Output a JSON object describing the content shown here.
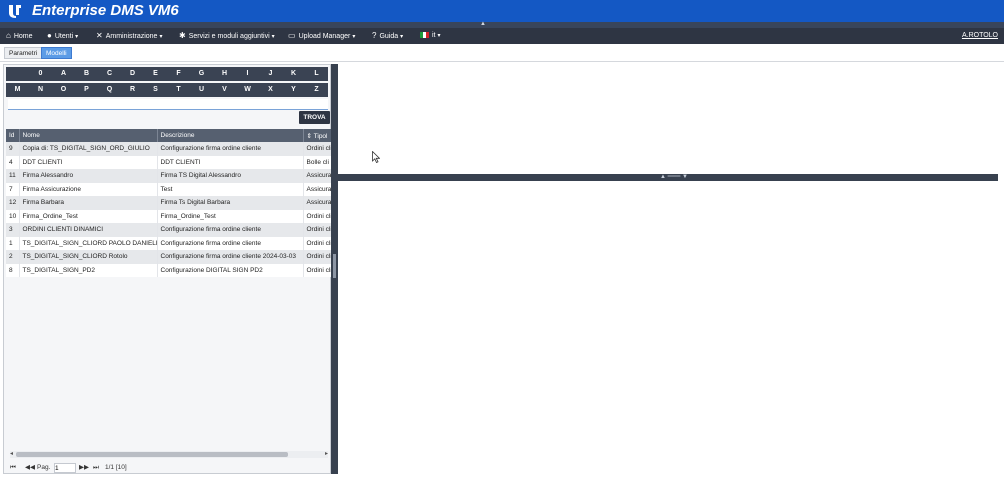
{
  "app": {
    "title": "Enterprise DMS VM6"
  },
  "menu": {
    "items": [
      {
        "label": "Home",
        "icon": "home-icon",
        "caret": false
      },
      {
        "label": "Utenti",
        "icon": "user-icon",
        "caret": true
      },
      {
        "label": "Amministrazione",
        "icon": "tools-icon",
        "caret": true
      },
      {
        "label": "Servizi e moduli aggiuntivi",
        "icon": "gear-icon",
        "caret": true
      },
      {
        "label": "Upload Manager",
        "icon": "upload-icon",
        "caret": true
      },
      {
        "label": "Guida",
        "icon": "help-icon",
        "caret": true
      },
      {
        "label": "it",
        "icon": "italy-flag-icon",
        "caret": true
      }
    ],
    "user": "A.ROTOLO"
  },
  "tabs": [
    {
      "label": "Parametri",
      "active": false
    },
    {
      "label": "Modelli",
      "active": true
    }
  ],
  "alphabet": {
    "row1": [
      "0",
      "A",
      "B",
      "C",
      "D",
      "E",
      "F",
      "G",
      "H",
      "I",
      "J",
      "K",
      "L"
    ],
    "row2": [
      "M",
      "N",
      "O",
      "P",
      "Q",
      "R",
      "S",
      "T",
      "U",
      "V",
      "W",
      "X",
      "Y",
      "Z"
    ]
  },
  "search": {
    "value": "",
    "button": "TROVA"
  },
  "table": {
    "columns": [
      "Id",
      "Nome",
      "Descrizione",
      "Tipol"
    ],
    "rows": [
      [
        "9",
        "Copia di: TS_DIGITAL_SIGN_ORD_GIULIO",
        "Configurazione firma ordine cliente",
        "Ordini cli"
      ],
      [
        "4",
        "DDT CLIENTI",
        "DDT CLIENTI",
        "Bolle cli"
      ],
      [
        "11",
        "Firma Alessandro",
        "Firma TS Digital Alessandro",
        "Assicura"
      ],
      [
        "7",
        "Firma Assicurazione",
        "Test",
        "Assicura"
      ],
      [
        "12",
        "Firma Barbara",
        "Firma Ts Digital Barbara",
        "Assicura"
      ],
      [
        "10",
        "Firma_Ordine_Test",
        "Firma_Ordine_Test",
        "Ordini cli"
      ],
      [
        "3",
        "ORDINI CLIENTI DINAMICI",
        "Configurazione firma ordine cliente",
        "Ordini cli"
      ],
      [
        "1",
        "TS_DIGITAL_SIGN_CLIORD PAOLO DANIELE",
        "Configurazione firma ordine cliente",
        "Ordini cli"
      ],
      [
        "2",
        "TS_DIGITAL_SIGN_CLIORD Rotolo",
        "Configurazione firma ordine cliente 2024-03-03",
        "Ordini cli"
      ],
      [
        "8",
        "TS_DIGITAL_SIGN_PD2",
        "Configurazione DIGITAL SIGN PD2",
        "Ordini cli"
      ]
    ]
  },
  "pager": {
    "label": "Pag.",
    "page": "1",
    "summary": "1/1 [10]"
  }
}
